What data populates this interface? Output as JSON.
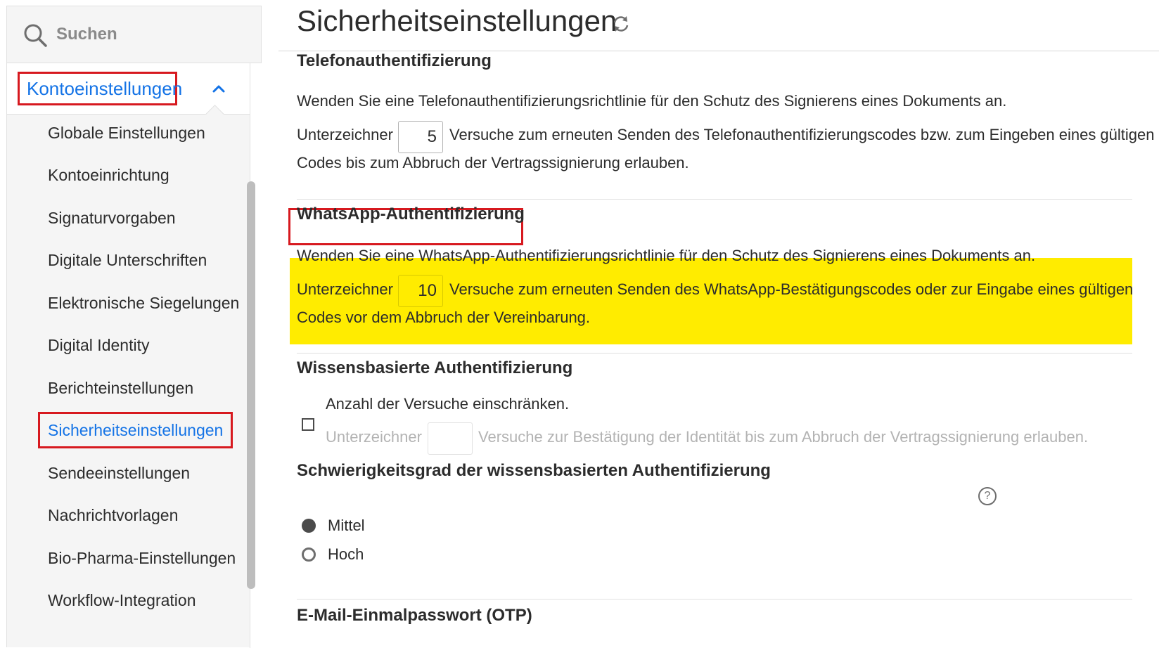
{
  "sidebar": {
    "search_placeholder": "Suchen",
    "section_label": "Kontoeinstellungen",
    "items": [
      {
        "label": "Globale Einstellungen"
      },
      {
        "label": "Kontoeinrichtung"
      },
      {
        "label": "Signaturvorgaben"
      },
      {
        "label": "Digitale Unterschriften"
      },
      {
        "label": "Elektronische Siegelungen"
      },
      {
        "label": "Digital Identity"
      },
      {
        "label": "Berichteinstellungen"
      },
      {
        "label": "Sicherheitseinstellungen"
      },
      {
        "label": "Sendeeinstellungen"
      },
      {
        "label": "Nachrichtvorlagen"
      },
      {
        "label": "Bio-Pharma-Einstellungen"
      },
      {
        "label": "Workflow-Integration"
      }
    ]
  },
  "main": {
    "title": "Sicherheitseinstellungen",
    "phone": {
      "heading": "Telefonauthentifizierung",
      "intro": "Wenden Sie eine Telefonauthentifizierungsrichtlinie für den Schutz des Signierens eines Dokuments an.",
      "prefix": "Unterzeichner",
      "value": "5",
      "suffix": "Versuche zum erneuten Senden des Telefonauthentifizierungscodes bzw. zum Eingeben eines gültigen",
      "line2": "Codes bis zum Abbruch der Vertragssignierung erlauben."
    },
    "whatsapp": {
      "heading": "WhatsApp-Authentifizierung",
      "intro": "Wenden Sie eine WhatsApp-Authentifizierungsrichtlinie für den Schutz des Signierens eines Dokuments an.",
      "prefix": "Unterzeichner",
      "value": "10",
      "suffix": "Versuche zum erneuten Senden des WhatsApp-Bestätigungscodes oder zur Eingabe eines gültigen",
      "line2": "Codes vor dem Abbruch der Vereinbarung."
    },
    "kba": {
      "heading": "Wissensbasierte Authentifizierung",
      "checkbox_label": "Anzahl der Versuche einschränken.",
      "prefix": "Unterzeichner",
      "value": "",
      "suffix": "Versuche zur Bestätigung der Identität bis zum Abbruch der Vertragssignierung erlauben.",
      "difficulty_heading": "Schwierigkeitsgrad der wissensbasierten Authentifizierung",
      "help_symbol": "?",
      "options": [
        {
          "label": "Mittel",
          "selected": true
        },
        {
          "label": "Hoch",
          "selected": false
        }
      ]
    },
    "otp": {
      "heading": "E-Mail-Einmalpasswort (OTP)"
    }
  },
  "colors": {
    "accent": "#1473e6",
    "annotation_red": "#d7191f",
    "highlight_yellow": "#ffec00"
  }
}
